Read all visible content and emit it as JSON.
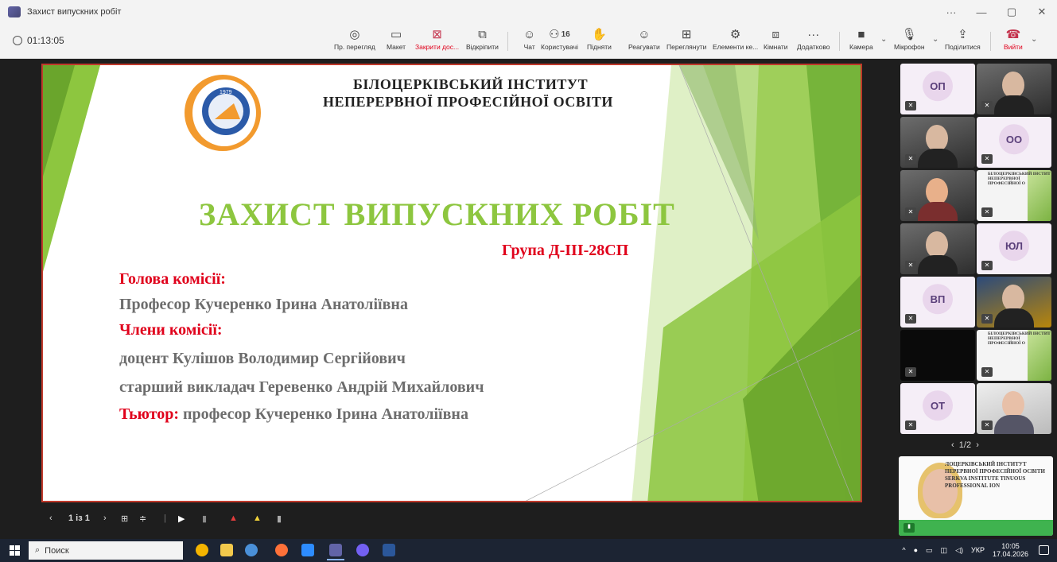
{
  "window": {
    "title": "Захист випускних робіт",
    "controls": [
      "···",
      "—",
      "▢",
      "✕"
    ]
  },
  "toolbar": {
    "timer": "01:13:05",
    "items": [
      {
        "label": "Пр. перегляд",
        "icon": "◎"
      },
      {
        "label": "Макет",
        "icon": "▭"
      },
      {
        "label": "Закрити дос...",
        "icon": "⊠"
      },
      {
        "label": "Відкріпити",
        "icon": "⧉"
      },
      {
        "label": "Чат",
        "icon": "☺"
      },
      {
        "label": "Користувачі",
        "icon": "⚇",
        "count": "16"
      },
      {
        "label": "Підняти",
        "icon": "✋"
      },
      {
        "label": "Реагувати",
        "icon": "☺"
      },
      {
        "label": "Переглянути",
        "icon": "⊞"
      },
      {
        "label": "Елементи ке...",
        "icon": "⚙"
      },
      {
        "label": "Кімнати",
        "icon": "⧈"
      },
      {
        "label": "Додатково",
        "icon": "···"
      },
      {
        "label": "Камера",
        "icon": "■"
      },
      {
        "label": "Мікрофон",
        "icon": "🎙"
      },
      {
        "label": "Поділитися",
        "icon": "⇪"
      },
      {
        "label": "Вийти",
        "icon": "☎"
      }
    ]
  },
  "slide": {
    "institute_line1": "БІЛОЦЕРКІВСЬКИЙ ІНСТИТУТ",
    "institute_line2": "НЕПЕРЕРВНОЇ ПРОФЕСІЙНОЇ ОСВІТИ",
    "logo_year": "1979",
    "title": "ЗАХИСТ ВИПУСКНИХ РОБІТ",
    "group": "Група  Д-ІІІ-28СП",
    "chair_label": "Голова комісії:",
    "chair_name": "Професор Кучеренко Ірина Анатоліївна",
    "members_label": "Члени комісії:",
    "member1": "доцент Кулішов Володимир Сергійович",
    "member2": "старший викладач Геревенко Андрій Михайлович",
    "tutor_label": "Тьютор:",
    "tutor_name": " професор Кучеренко Ірина Анатоліївна",
    "colors": {
      "accent_green": "#8dc63f",
      "red": "#e0001b",
      "grey": "#6d6d6d"
    }
  },
  "stage_footer": {
    "prev": "‹",
    "page": "1 із 1",
    "next": "›"
  },
  "participants": {
    "tiles": [
      {
        "initials": "ОП",
        "kind": "avatar"
      },
      {
        "initials": "",
        "kind": "photo"
      },
      {
        "initials": "",
        "kind": "photo"
      },
      {
        "initials": "ОО",
        "kind": "avatar"
      },
      {
        "initials": "",
        "kind": "photo"
      },
      {
        "initials": "",
        "kind": "slidecam"
      },
      {
        "initials": "",
        "kind": "photo"
      },
      {
        "initials": "ЮЛ",
        "kind": "avatar"
      },
      {
        "initials": "ВП",
        "kind": "avatar"
      },
      {
        "initials": "",
        "kind": "photo"
      },
      {
        "initials": "",
        "kind": "black"
      },
      {
        "initials": "",
        "kind": "slidecam"
      },
      {
        "initials": "ОТ",
        "kind": "avatar"
      },
      {
        "initials": "",
        "kind": "photo"
      }
    ],
    "pager": "1/2",
    "slidecam_text": "БІЛОЦЕРКІВСЬКИЙ ІНСТИТ НЕПЕРЕРВНОЇ ПРОФЕСІЙНОЇ О",
    "self_text": "ЛОЦЕРКІВСЬКИЙ ІНСТИТУТ ПЕРЕРВНОЇ ПРОФЕСІЙНОЇ ОСВІТИ SERKVA INSTITUTE TINUOUS PROFESSIONAL ION"
  },
  "taskbar": {
    "search_placeholder": "Поиск",
    "language": "УКР",
    "time": "10:05",
    "date": "17.04.2026",
    "apps": [
      {
        "name": "chrome",
        "color": "#f4b400"
      },
      {
        "name": "files",
        "color": "#f2c94c"
      },
      {
        "name": "app-blue",
        "color": "#4a90d9"
      },
      {
        "name": "firefox",
        "color": "#ff7139"
      },
      {
        "name": "zoom",
        "color": "#2d8cff"
      },
      {
        "name": "teams",
        "color": "#6264a7"
      },
      {
        "name": "viber",
        "color": "#7360f2"
      },
      {
        "name": "word",
        "color": "#2b579a"
      }
    ]
  }
}
